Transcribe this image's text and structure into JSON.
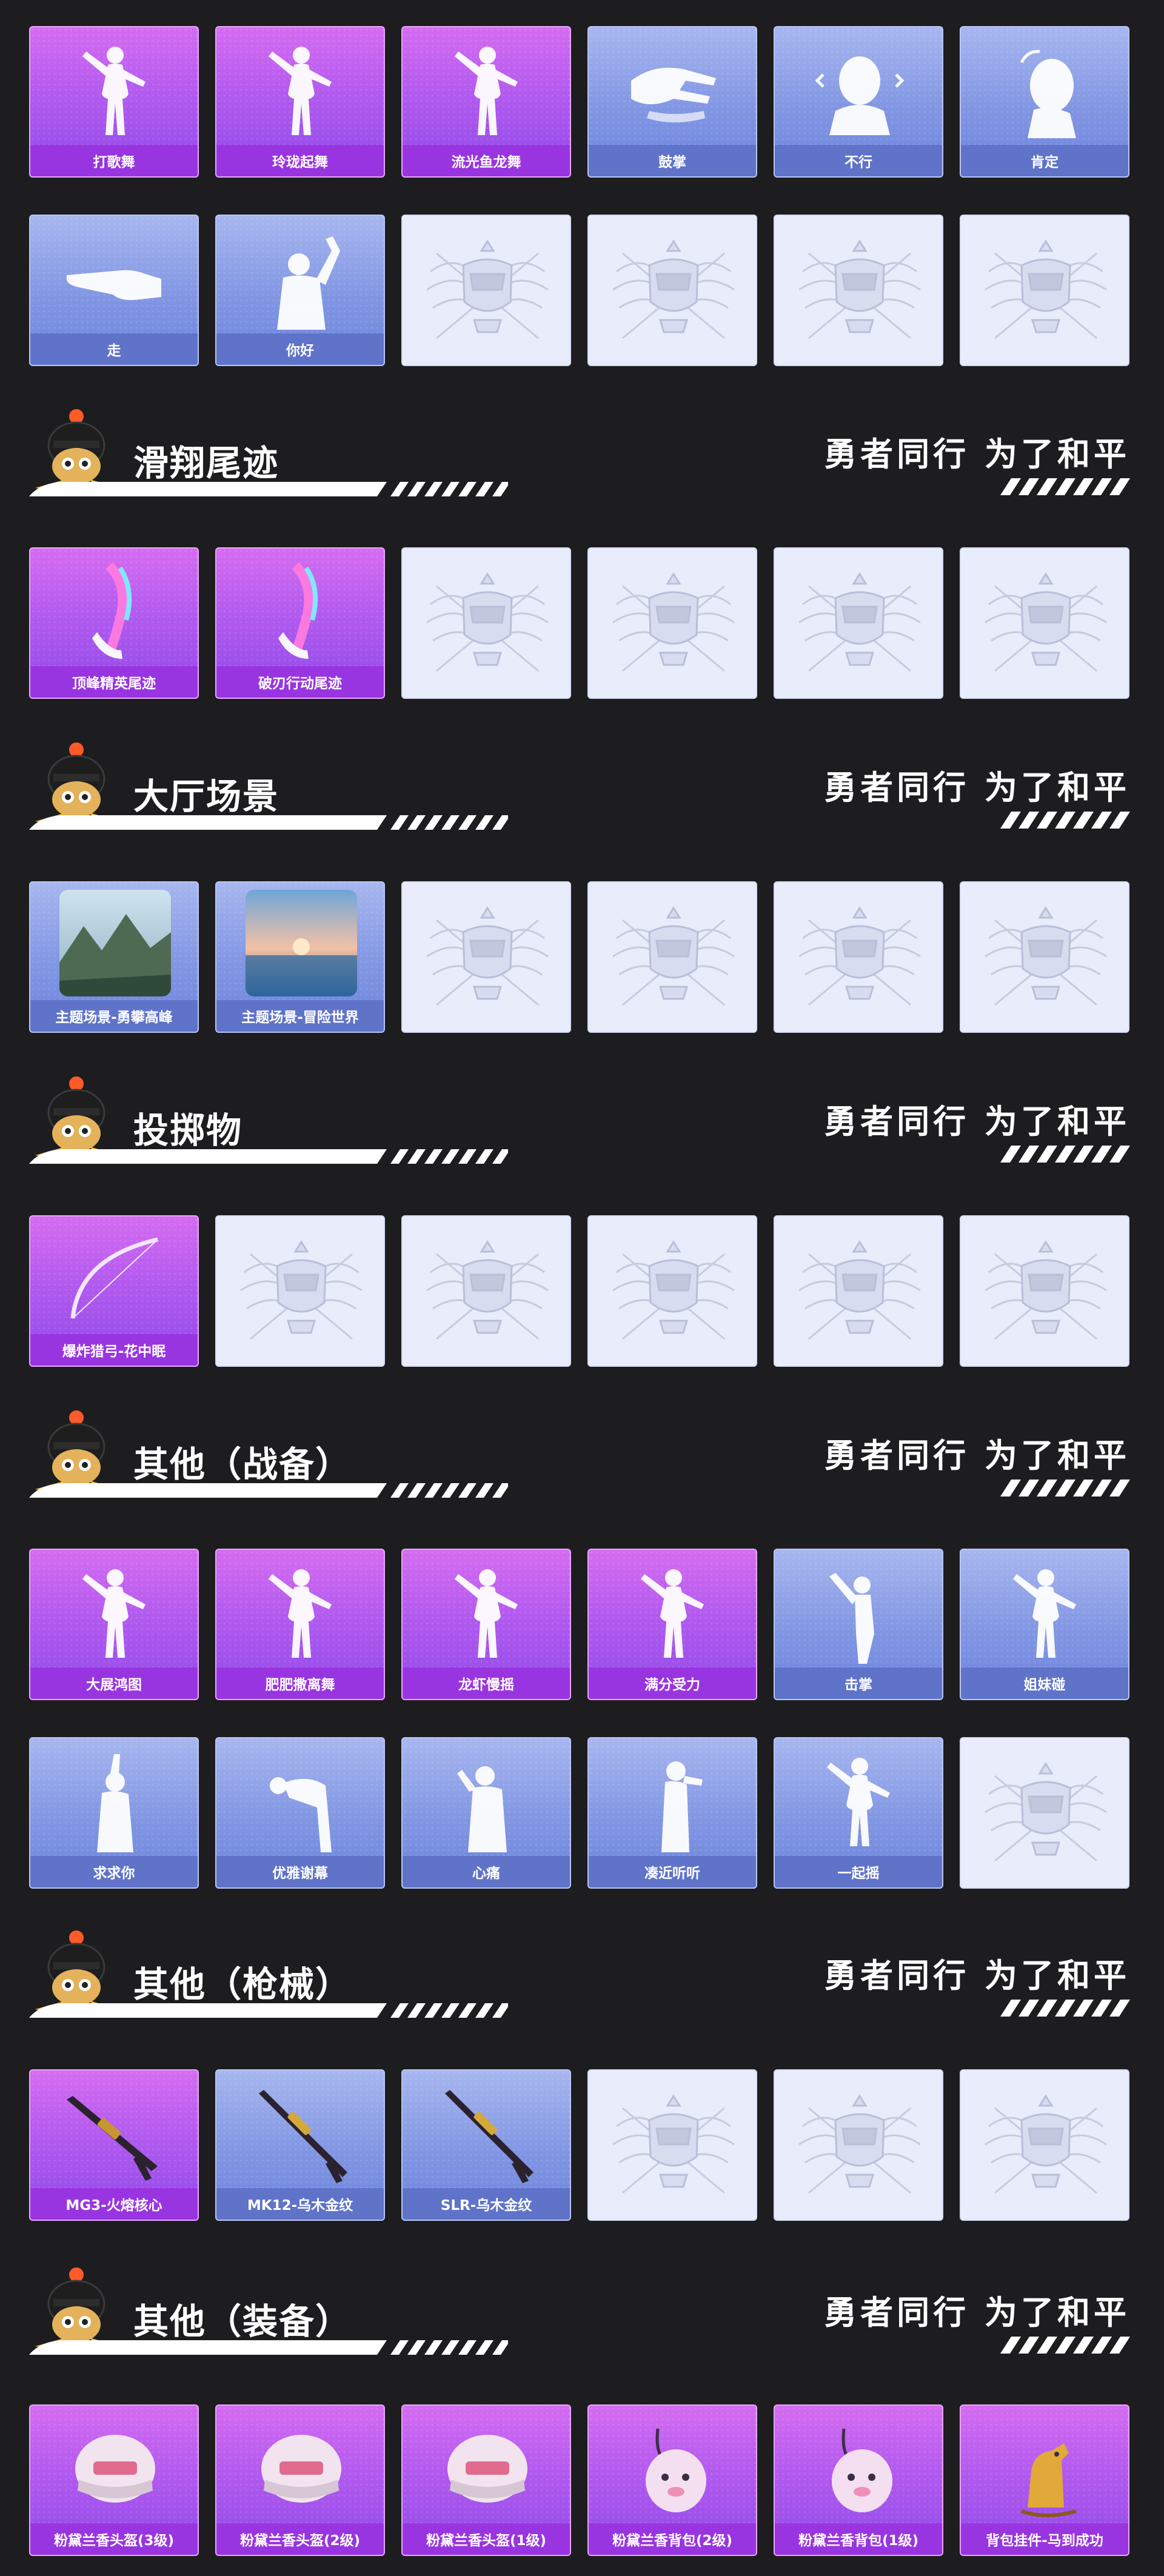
{
  "slogan": "勇者同行 为了和平",
  "colors": {
    "page_bg": "#1d1d1f",
    "purple_card": "#b25aef",
    "blue_card": "#8196e3",
    "empty_card": "#e9ecfb"
  },
  "top_rows": [
    [
      {
        "label": "打歌舞",
        "tier": "purple",
        "icon": "dancer-icon"
      },
      {
        "label": "玲珑起舞",
        "tier": "purple",
        "icon": "dancer-icon"
      },
      {
        "label": "流光鱼龙舞",
        "tier": "purple",
        "icon": "dancer-icon"
      },
      {
        "label": "鼓掌",
        "tier": "blue",
        "icon": "clap-icon"
      },
      {
        "label": "不行",
        "tier": "blue",
        "icon": "head-shake-icon"
      },
      {
        "label": "肯定",
        "tier": "blue",
        "icon": "nod-icon"
      }
    ],
    [
      {
        "label": "走",
        "tier": "blue",
        "icon": "point-icon"
      },
      {
        "label": "你好",
        "tier": "blue",
        "icon": "wave-icon"
      },
      {
        "label": "",
        "tier": "empty",
        "icon": "empty-slot-emblem-icon"
      },
      {
        "label": "",
        "tier": "empty",
        "icon": "empty-slot-emblem-icon"
      },
      {
        "label": "",
        "tier": "empty",
        "icon": "empty-slot-emblem-icon"
      },
      {
        "label": "",
        "tier": "empty",
        "icon": "empty-slot-emblem-icon"
      }
    ]
  ],
  "sections": [
    {
      "title": "滑翔尾迹",
      "rows": [
        [
          {
            "label": "顶峰精英尾迹",
            "tier": "purple",
            "icon": "glide-trail-icon"
          },
          {
            "label": "破刃行动尾迹",
            "tier": "purple",
            "icon": "glide-trail-icon"
          },
          {
            "label": "",
            "tier": "empty",
            "icon": "empty-slot-emblem-icon"
          },
          {
            "label": "",
            "tier": "empty",
            "icon": "empty-slot-emblem-icon"
          },
          {
            "label": "",
            "tier": "empty",
            "icon": "empty-slot-emblem-icon"
          },
          {
            "label": "",
            "tier": "empty",
            "icon": "empty-slot-emblem-icon"
          }
        ]
      ]
    },
    {
      "title": "大厅场景",
      "rows": [
        [
          {
            "label": "主题场景-勇攀高峰",
            "tier": "blue",
            "icon": "mountain-scene-icon"
          },
          {
            "label": "主题场景-冒险世界",
            "tier": "blue",
            "icon": "sea-scene-icon"
          },
          {
            "label": "",
            "tier": "empty",
            "icon": "empty-slot-emblem-icon"
          },
          {
            "label": "",
            "tier": "empty",
            "icon": "empty-slot-emblem-icon"
          },
          {
            "label": "",
            "tier": "empty",
            "icon": "empty-slot-emblem-icon"
          },
          {
            "label": "",
            "tier": "empty",
            "icon": "empty-slot-emblem-icon"
          }
        ]
      ]
    },
    {
      "title": "投掷物",
      "rows": [
        [
          {
            "label": "爆炸猎弓-花中眠",
            "tier": "purple",
            "icon": "bow-icon"
          },
          {
            "label": "",
            "tier": "empty",
            "icon": "empty-slot-emblem-icon"
          },
          {
            "label": "",
            "tier": "empty",
            "icon": "empty-slot-emblem-icon"
          },
          {
            "label": "",
            "tier": "empty",
            "icon": "empty-slot-emblem-icon"
          },
          {
            "label": "",
            "tier": "empty",
            "icon": "empty-slot-emblem-icon"
          },
          {
            "label": "",
            "tier": "empty",
            "icon": "empty-slot-emblem-icon"
          }
        ]
      ]
    },
    {
      "title": "其他（战备）",
      "rows": [
        [
          {
            "label": "大展鸿图",
            "tier": "purple",
            "icon": "dancer-icon"
          },
          {
            "label": "肥肥撒离舞",
            "tier": "purple",
            "icon": "dancer-icon"
          },
          {
            "label": "龙虾慢摇",
            "tier": "purple",
            "icon": "dancer-icon"
          },
          {
            "label": "满分受力",
            "tier": "purple",
            "icon": "dancer-icon"
          },
          {
            "label": "击掌",
            "tier": "blue",
            "icon": "high-five-icon"
          },
          {
            "label": "姐妹碰",
            "tier": "blue",
            "icon": "dancer-icon"
          }
        ],
        [
          {
            "label": "求求你",
            "tier": "blue",
            "icon": "plead-icon"
          },
          {
            "label": "优雅谢幕",
            "tier": "blue",
            "icon": "bow-down-icon"
          },
          {
            "label": "心痛",
            "tier": "blue",
            "icon": "heartache-icon"
          },
          {
            "label": "凑近听听",
            "tier": "blue",
            "icon": "listen-icon"
          },
          {
            "label": "一起摇",
            "tier": "blue",
            "icon": "dancer-icon"
          },
          {
            "label": "",
            "tier": "empty",
            "icon": "empty-slot-emblem-icon"
          }
        ]
      ]
    },
    {
      "title": "其他（枪械）",
      "rows": [
        [
          {
            "label": "MG3-火熔核心",
            "tier": "purple",
            "icon": "machine-gun-icon"
          },
          {
            "label": "MK12-乌木金纹",
            "tier": "blue",
            "icon": "rifle-icon"
          },
          {
            "label": "SLR-乌木金纹",
            "tier": "blue",
            "icon": "rifle-icon"
          },
          {
            "label": "",
            "tier": "empty",
            "icon": "empty-slot-emblem-icon"
          },
          {
            "label": "",
            "tier": "empty",
            "icon": "empty-slot-emblem-icon"
          },
          {
            "label": "",
            "tier": "empty",
            "icon": "empty-slot-emblem-icon"
          }
        ]
      ]
    },
    {
      "title": "其他（装备）",
      "rows": [
        [
          {
            "label": "粉黛兰香头盔(3级)",
            "tier": "purple",
            "icon": "helmet-icon"
          },
          {
            "label": "粉黛兰香头盔(2级)",
            "tier": "purple",
            "icon": "helmet-icon"
          },
          {
            "label": "粉黛兰香头盔(1级)",
            "tier": "purple",
            "icon": "helmet-icon"
          },
          {
            "label": "粉黛兰香背包(2级)",
            "tier": "purple",
            "icon": "backpack-icon"
          },
          {
            "label": "粉黛兰香背包(1级)",
            "tier": "purple",
            "icon": "backpack-icon"
          },
          {
            "label": "背包挂件-马到成功",
            "tier": "purple",
            "icon": "horse-charm-icon"
          }
        ]
      ]
    }
  ]
}
